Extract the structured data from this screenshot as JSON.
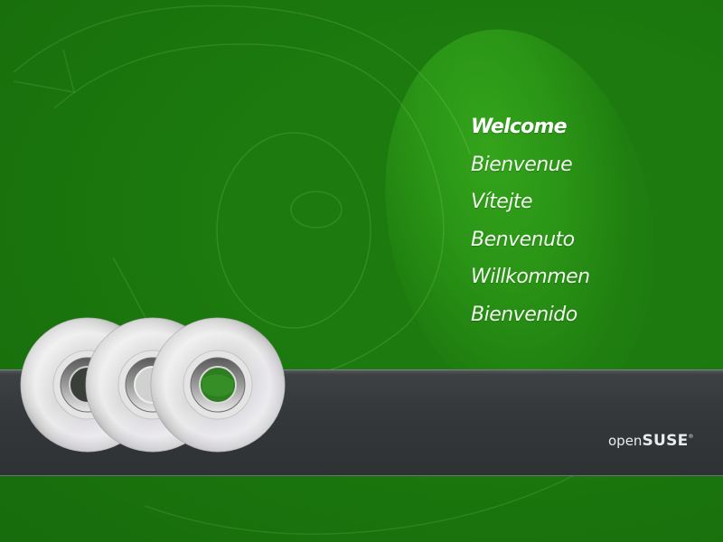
{
  "welcome_screen": {
    "languages": [
      {
        "label": "Welcome",
        "selected": true
      },
      {
        "label": "Bienvenue",
        "selected": false
      },
      {
        "label": "Vítejte",
        "selected": false
      },
      {
        "label": "Benvenuto",
        "selected": false
      },
      {
        "label": "Willkommen",
        "selected": false
      },
      {
        "label": "Bienvenido",
        "selected": false
      }
    ]
  },
  "branding": {
    "logo_light": "open",
    "logo_bold": "SUSE",
    "trademark": "®"
  },
  "discs": {
    "count": 3,
    "icon": "cd-disc-icon"
  },
  "colors": {
    "background": "#1c7a0e",
    "glow": "#34a41b",
    "bar": "#34383a",
    "text": "#ffffff"
  }
}
